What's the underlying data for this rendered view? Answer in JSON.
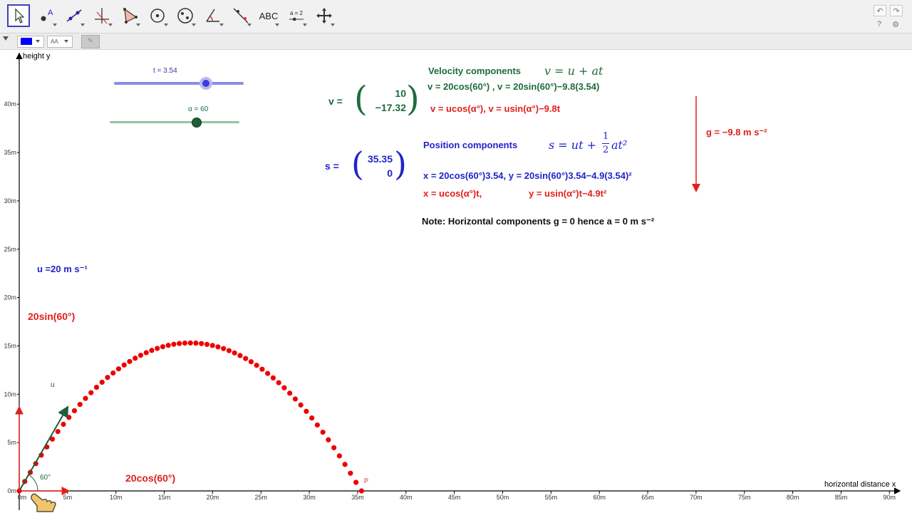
{
  "toolbar": {
    "tools": [
      {
        "icon": "move-arrow-icon",
        "selected": true
      },
      {
        "icon": "point-icon"
      },
      {
        "icon": "line-icon"
      },
      {
        "icon": "perpendicular-line-icon"
      },
      {
        "icon": "polygon-icon"
      },
      {
        "icon": "circle-icon"
      },
      {
        "icon": "ellipse-icon"
      },
      {
        "icon": "angle-icon"
      },
      {
        "icon": "reflect-icon"
      },
      {
        "icon": "text-tool-icon",
        "label": "ABC"
      },
      {
        "icon": "slider-icon",
        "label": "a = 2"
      },
      {
        "icon": "move-view-icon"
      }
    ],
    "help_label": "?",
    "settings_label": "⚙"
  },
  "stylebar": {
    "color": "#0000ff",
    "font_label": "AA"
  },
  "graph": {
    "y_axis_label": "height y",
    "x_axis_label": "horizontal distance x",
    "x_ticks": [
      "0m",
      "5m",
      "10m",
      "15m",
      "20m",
      "25m",
      "30m",
      "35m",
      "40m",
      "45m",
      "50m",
      "55m",
      "60m",
      "65m",
      "70m",
      "75m",
      "80m",
      "85m",
      "90m"
    ],
    "y_ticks": [
      "0m",
      "5m",
      "10m",
      "15m",
      "20m",
      "25m",
      "30m",
      "35m",
      "40m"
    ]
  },
  "sliders": {
    "t_label": "t = 3.54",
    "t_value": 3.54,
    "t_min": 0,
    "t_max": 5,
    "alpha_label": "α = 60",
    "alpha_value": 60,
    "alpha_min": 0,
    "alpha_max": 90
  },
  "velocity": {
    "heading": "Velocity components",
    "formula": "v = u + at",
    "v_label": "v =",
    "vx": "10",
    "vy": "−17.32",
    "line1": "v  = 20cos(60°) , v  = 20sin(60°)−9.8(3.54)",
    "line2": "v  = ucos(α°),     v  = usin(α°)−9.8t"
  },
  "position": {
    "heading": "Position components",
    "formula_lhs": "s = ut +",
    "formula_num": "1",
    "formula_den": "2",
    "formula_rhs": "at²",
    "s_label": "s =",
    "sx": "35.35",
    "sy": "0",
    "line1": "x = 20cos(60°)3.54, y = 20sin(60°)3.54−4.9(3.54)²",
    "line2a": "x = ucos(α°)t,",
    "line2b": "y = usin(α°)t−4.9t²"
  },
  "gravity_label": "g = −9.8 m s⁻²",
  "note": "Note: Horizontal components g = 0 hence a = 0 m s⁻²",
  "initial_speed_label": "u =20 m s⁻¹",
  "vertical_component_label": "20sin(60°)",
  "horizontal_component_label": "20cos(60°)",
  "vector_label": "u",
  "angle_label": "60°",
  "point_label": "P",
  "colors": {
    "trajectory": "#ee0000",
    "velocity_vector": "#1e5e3a",
    "components": "#e0201c"
  }
}
